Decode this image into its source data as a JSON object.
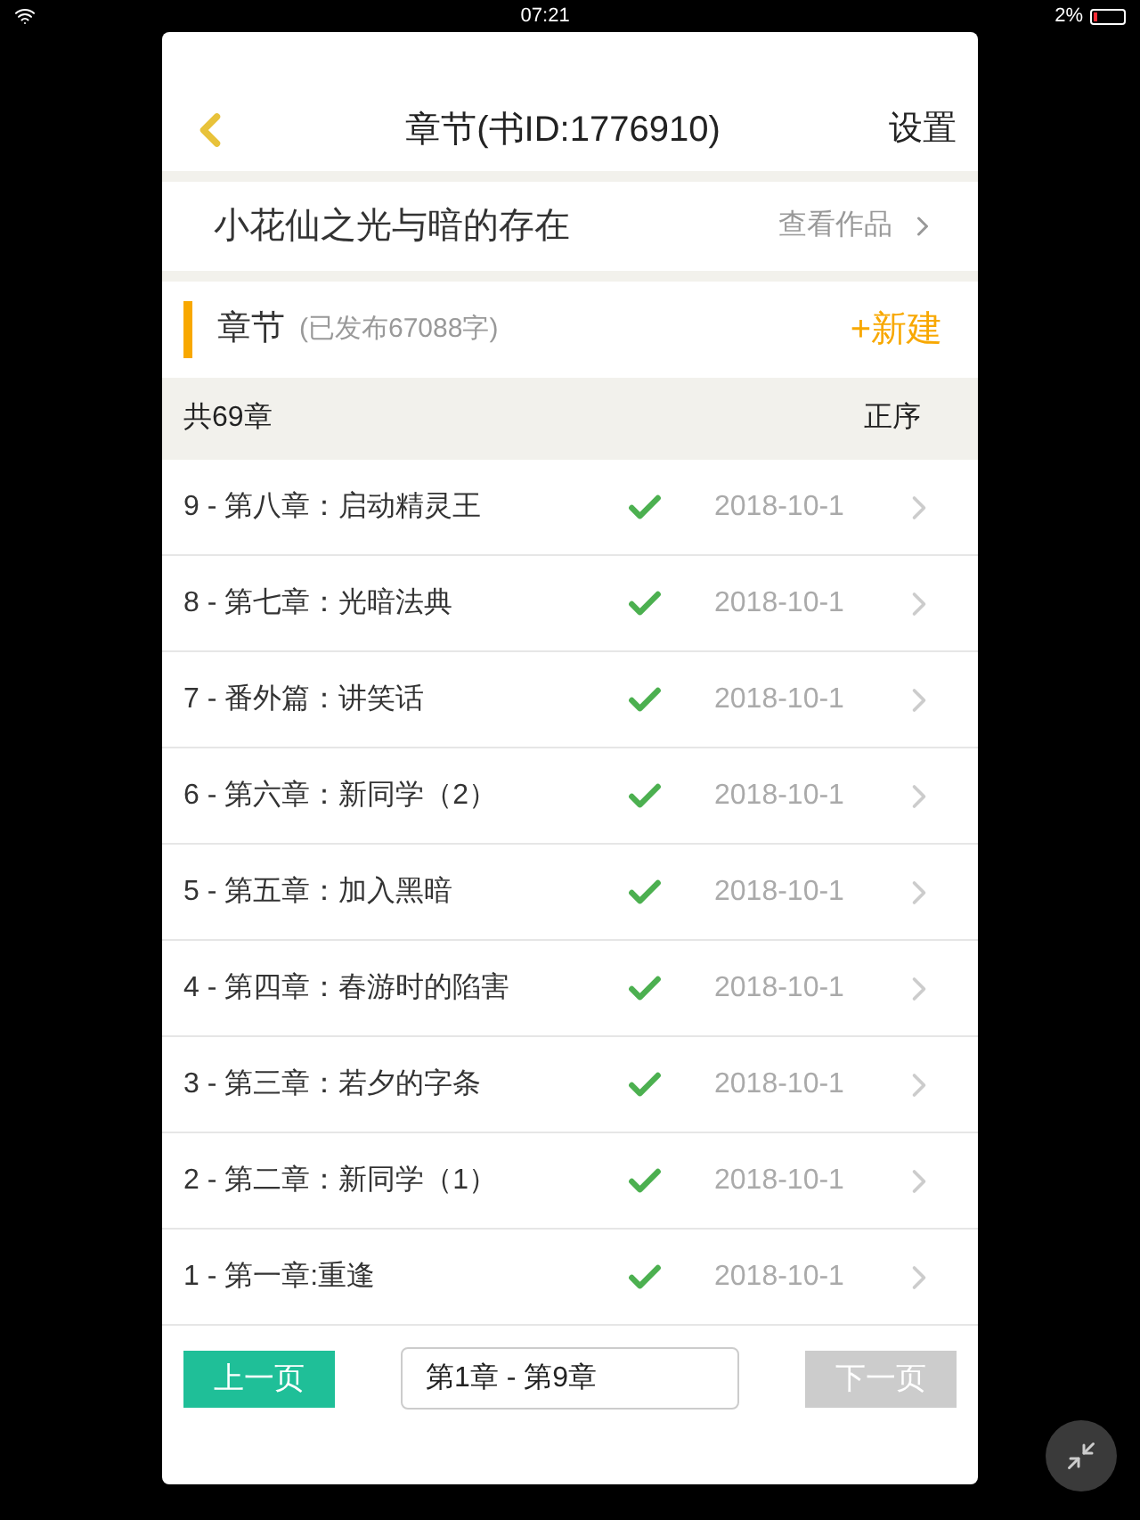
{
  "status_bar": {
    "time": "07:21",
    "battery": "2%"
  },
  "header": {
    "title": "章节(书ID:1776910)",
    "settings": "设置"
  },
  "book": {
    "title": "小花仙之光与暗的存在",
    "link": "查看作品"
  },
  "section": {
    "title": "章节",
    "subtitle": "(已发布67088字)",
    "new_button": "+新建"
  },
  "list_header": {
    "count": "共69章",
    "order": "正序"
  },
  "chapters": [
    {
      "title": "9 - 第八章：启动精灵王",
      "published": true,
      "date": "2018-10-1"
    },
    {
      "title": "8 - 第七章：光暗法典",
      "published": true,
      "date": "2018-10-1"
    },
    {
      "title": "7 - 番外篇：讲笑话",
      "published": true,
      "date": "2018-10-1"
    },
    {
      "title": "6 - 第六章：新同学（2）",
      "published": true,
      "date": "2018-10-1"
    },
    {
      "title": "5 - 第五章：加入黑暗",
      "published": true,
      "date": "2018-10-1"
    },
    {
      "title": "4 - 第四章：春游时的陷害",
      "published": true,
      "date": "2018-10-1"
    },
    {
      "title": "3 - 第三章：若夕的字条",
      "published": true,
      "date": "2018-10-1"
    },
    {
      "title": "2 - 第二章：新同学（1）",
      "published": true,
      "date": "2018-10-1"
    },
    {
      "title": "1 - 第一章:重逢",
      "published": true,
      "date": "2018-10-1"
    }
  ],
  "pagination": {
    "prev": {
      "label": "上一页",
      "disabled": false
    },
    "range": "第1章 - 第9章",
    "next": {
      "label": "下一页",
      "disabled": true
    }
  }
}
